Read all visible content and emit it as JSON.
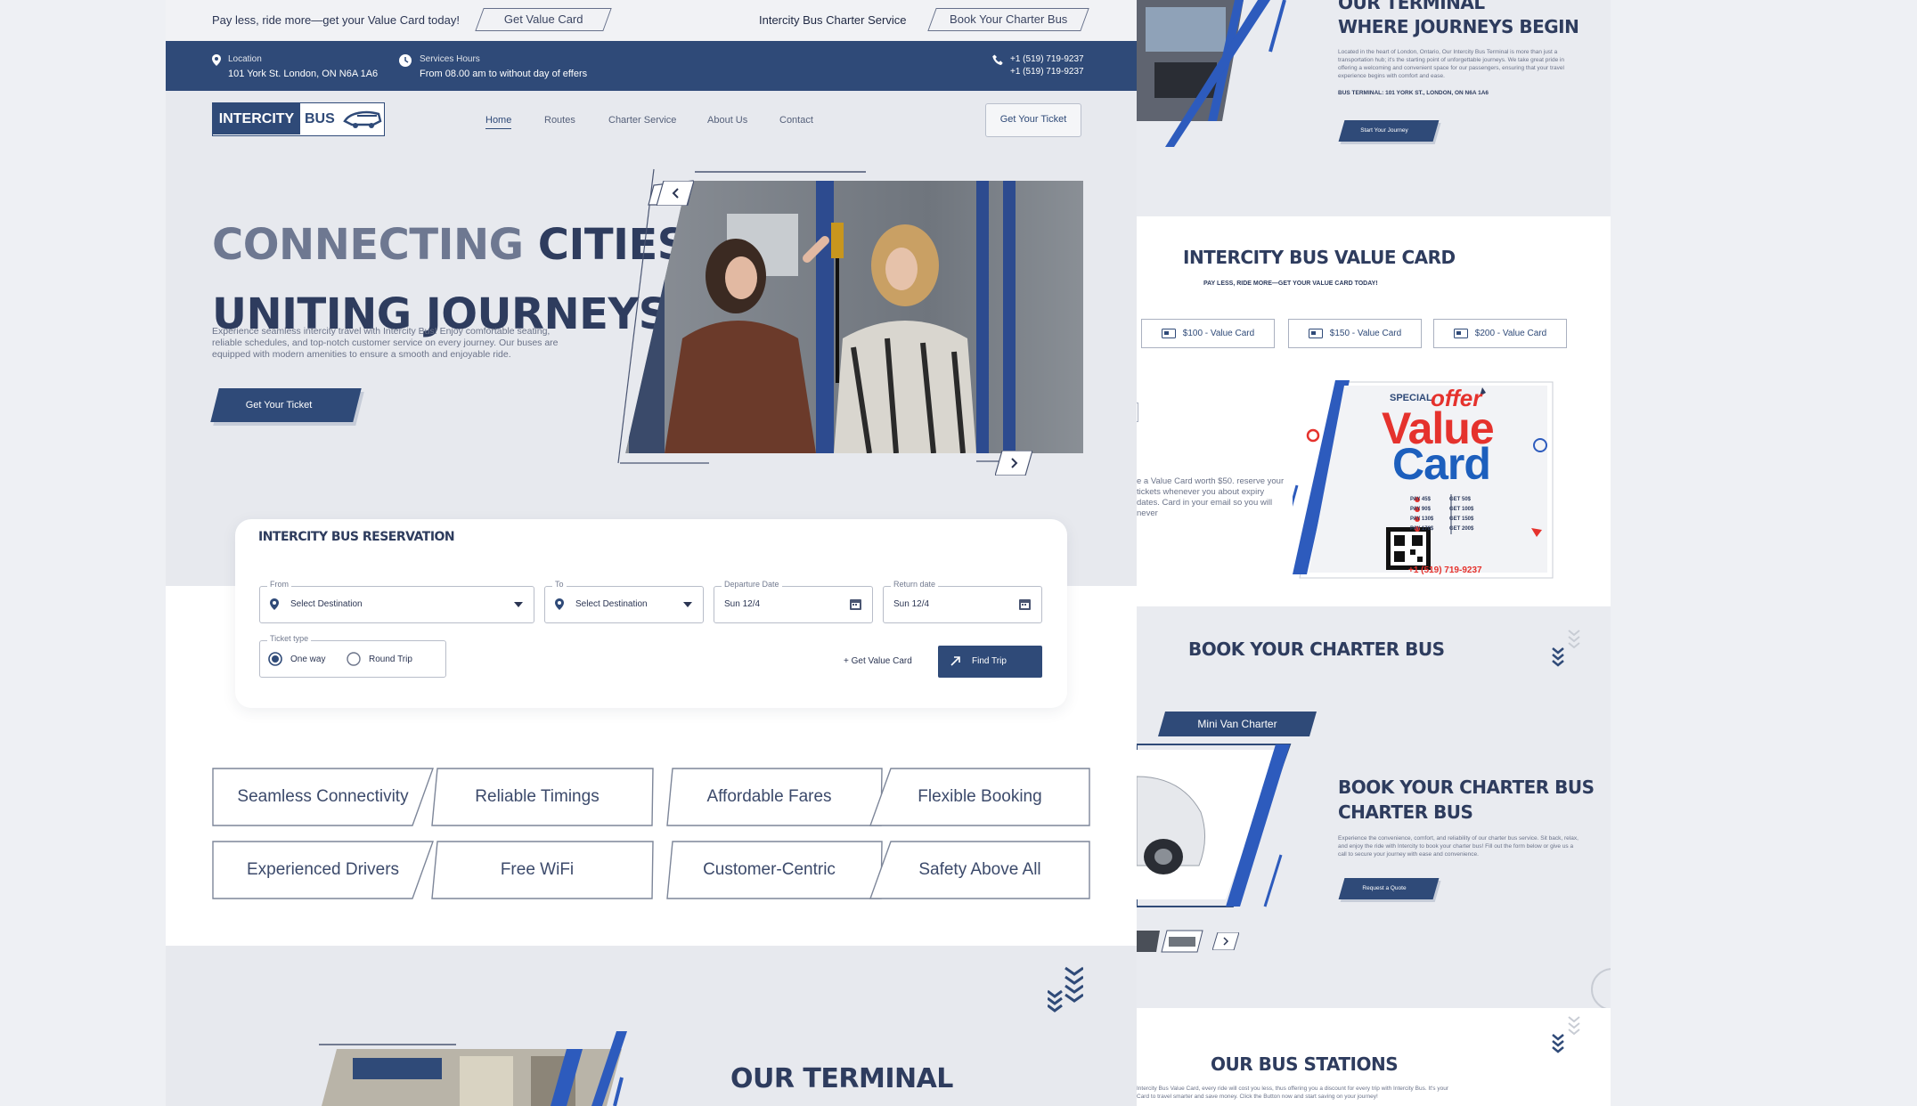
{
  "topbar": {
    "promo": "Pay less, ride more—get your Value Card today!",
    "value_card_btn": "Get Value Card",
    "charter_text": "Intercity Bus Charter Service",
    "charter_btn": "Book Your Charter Bus"
  },
  "infobar": {
    "location_label": "Location",
    "location_value": "101 York St. London, ON N6A 1A6",
    "hours_label": "Services Hours",
    "hours_value": "From 08.00 am to without day of effers",
    "phone1": "+1 (519) 719-9237",
    "phone2": "+1 (519) 719-9237"
  },
  "logo": {
    "word1": "INTERCITY",
    "word2": "BUS"
  },
  "nav": {
    "home": "Home",
    "routes": "Routes",
    "charter": "Charter Service",
    "about": "About Us",
    "contact": "Contact",
    "cta": "Get Your Ticket"
  },
  "hero": {
    "title_l1_a": "CONNECTING",
    "title_l1_b": "CITIES",
    "title_l2": "UNITING JOURNEYS",
    "desc": "Experience seamless intercity travel with Intercity Bus! Enjoy comfortable seating, reliable schedules, and top-notch customer service on every journey. Our buses are equipped with modern amenities to ensure a smooth and enjoyable ride.",
    "cta": "Get Your Ticket"
  },
  "reservation": {
    "title": "INTERCITY BUS RESERVATION",
    "from_label": "From",
    "from_value": "Select Destination",
    "to_label": "To",
    "to_value": "Select Destination",
    "dep_label": "Departure Date",
    "dep_value": "Sun 12/4",
    "ret_label": "Return date",
    "ret_value": "Sun 12/4",
    "ticket_type_label": "Ticket type",
    "one_way": "One way",
    "round_trip": "Round Trip",
    "value_card_link": "Get Value Card",
    "find": "Find Trip"
  },
  "features": [
    "Seamless Connectivity",
    "Reliable Timings",
    "Affordable Fares",
    "Flexible Booking",
    "Experienced Drivers",
    "Free WiFi",
    "Customer-Centric",
    "Safety Above All"
  ],
  "terminal_title": "OUR TERMINAL",
  "right": {
    "terminal_title_l1": "OUR TERMINAL",
    "terminal_title_l2": "WHERE JOURNEYS BEGIN",
    "terminal_desc": "Located in the heart of London, Ontario, Our Intercity Bus Terminal is more than just a transportation hub; it's the starting point of unforgettable journeys. We take great pride in offering a welcoming and convenient space for our passengers, ensuring that your travel experience begins with comfort and ease.",
    "terminal_addr": "BUS TERMINAL: 101 YORK ST., LONDON, ON N6A 1A6",
    "terminal_btn": "Start Your Journey",
    "value_title": "INTERCITY BUS VALUE CARD",
    "value_sub": "PAY LESS, RIDE MORE—GET YOUR VALUE CARD TODAY!",
    "value_cards": [
      "$100 - Value Card",
      "$150 - Value Card",
      "$200 - Value Card"
    ],
    "value_text": "e a Value Card worth $50. reserve your tickets whenever you about expiry dates. Card in your email so you will never",
    "card_special": "SPECIAL",
    "card_offer": "offer",
    "card_value": "Value",
    "card_card": "Card",
    "card_pay": [
      "PAY 45$",
      "PAY 90$",
      "PAY 130$",
      "PAY 170$"
    ],
    "card_get": [
      "GET 50$",
      "GET 100$",
      "GET 150$",
      "GET 200$"
    ],
    "card_phone": "+1 (519) 719-9237",
    "charter_head": "BOOK YOUR CHARTER BUS",
    "charter_tab": "Mini Van Charter",
    "charter_title_l1": "BOOK YOUR CHARTER BUS",
    "charter_title_l2": "CHARTER BUS",
    "charter_desc": "Experience the convenience, comfort, and reliability of our charter bus service. Sit back, relax, and enjoy the ride with Intercity to book your charter bus! Fill out the form below or give us a call to secure your journey with ease and convenience.",
    "charter_btn": "Request a Quote",
    "stations_title": "OUR BUS STATIONS",
    "stations_desc": "Intercity Bus Value Card, every ride will cost you less, thus offering you a discount for every trip with Intercity Bus. It's your Card to travel smarter and save money. Click the Button now and start saving on your journey!"
  }
}
